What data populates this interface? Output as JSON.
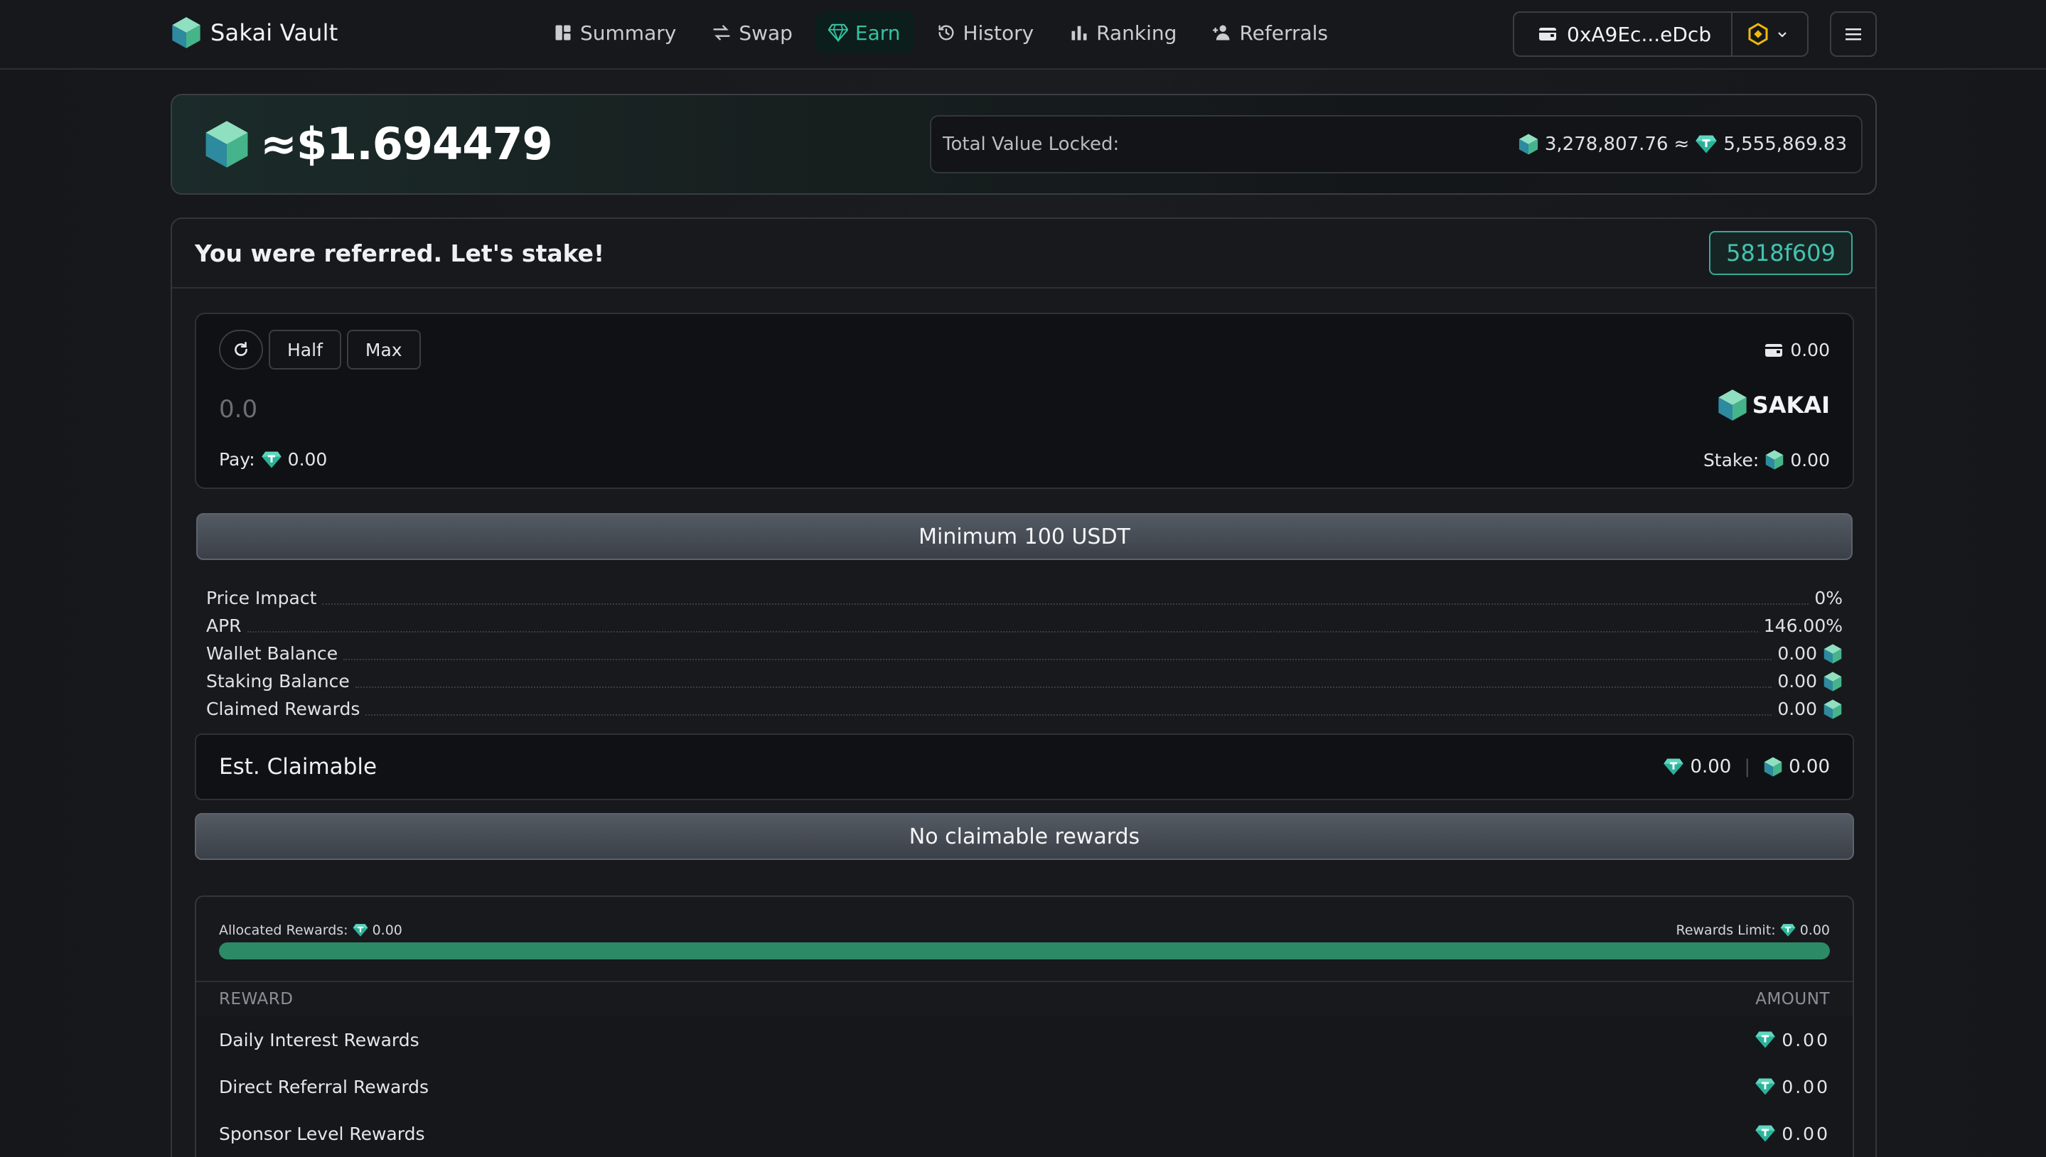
{
  "brand": {
    "name": "Sakai Vault"
  },
  "nav": {
    "items": [
      {
        "label": "Summary",
        "icon": "dashboard-icon"
      },
      {
        "label": "Swap",
        "icon": "swap-arrows-icon"
      },
      {
        "label": "Earn",
        "icon": "gem-icon",
        "active": true
      },
      {
        "label": "History",
        "icon": "history-clock-icon"
      },
      {
        "label": "Ranking",
        "icon": "bar-chart-icon"
      },
      {
        "label": "Referrals",
        "icon": "user-plus-icon"
      }
    ]
  },
  "wallet": {
    "address": "0xA9Ec...eDcb",
    "network_icon": "bnb-icon"
  },
  "price": {
    "value": "≈$1.694479"
  },
  "tvl": {
    "label": "Total Value Locked:",
    "sakai_amount": "3,278,807.76",
    "approx": "≈",
    "usdt_amount": "5,555,869.83"
  },
  "stake": {
    "title": "You were referred. Let's stake!",
    "referral_code": "5818f609",
    "half_label": "Half",
    "max_label": "Max",
    "wallet_balance": "0.00",
    "amount_placeholder": "0.0",
    "token_symbol": "SAKAI",
    "pay_label": "Pay:",
    "pay_amount": "0.00",
    "stake_label": "Stake:",
    "stake_amount": "0.00",
    "action_button": "Minimum 100 USDT"
  },
  "stats": [
    {
      "label": "Price Impact",
      "value": "0%",
      "icon": false
    },
    {
      "label": "APR",
      "value": "146.00%",
      "icon": false
    },
    {
      "label": "Wallet Balance",
      "value": "0.00",
      "icon": true
    },
    {
      "label": "Staking Balance",
      "value": "0.00",
      "icon": true
    },
    {
      "label": "Claimed Rewards",
      "value": "0.00",
      "icon": true
    }
  ],
  "claimable": {
    "title": "Est. Claimable",
    "usdt_amount": "0.00",
    "separator": "|",
    "sakai_amount": "0.00",
    "button": "No claimable rewards"
  },
  "rewards": {
    "allocated_label": "Allocated Rewards:",
    "allocated_amount": "0.00",
    "limit_label": "Rewards Limit:",
    "limit_amount": "0.00",
    "progress_percent": 100,
    "col_reward": "REWARD",
    "col_amount": "AMOUNT",
    "rows": [
      {
        "label": "Daily Interest Rewards",
        "amount": "0.00"
      },
      {
        "label": "Direct Referral Rewards",
        "amount": "0.00"
      },
      {
        "label": "Sponsor Level Rewards",
        "amount": "0.00"
      }
    ]
  },
  "colors": {
    "accent": "#35c2a4",
    "progress": "#2d8a67",
    "background": "#16181c"
  }
}
